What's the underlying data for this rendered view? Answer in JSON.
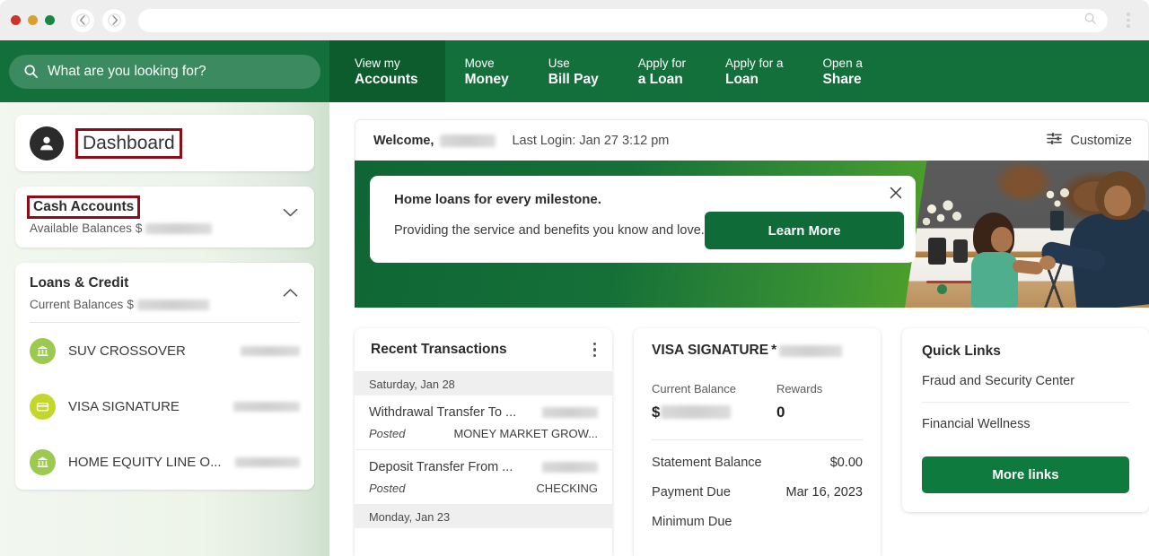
{
  "browser": {
    "back_icon": "back-arrow-icon",
    "forward_icon": "forward-arrow-icon",
    "url_value": "",
    "url_search_icon": "search-icon",
    "menu_icon": "kebab-menu-icon"
  },
  "search": {
    "placeholder": "What are you looking for?",
    "icon": "search-icon"
  },
  "nav": {
    "tabs": [
      {
        "line1": "View my",
        "line2": "Accounts",
        "active": true
      },
      {
        "line1": "Move",
        "line2": "Money",
        "active": false
      },
      {
        "line1": "Use",
        "line2": "Bill Pay",
        "active": false
      },
      {
        "line1": "Apply for",
        "line2": "a Loan",
        "active": false
      },
      {
        "line1": "Apply for a",
        "line2": "Loan",
        "active": false
      },
      {
        "line1": "Open a",
        "line2": "Share",
        "active": false
      }
    ]
  },
  "sidebar": {
    "dashboard": {
      "label": "Dashboard",
      "avatar_icon": "user-avatar-icon",
      "annotated": true
    },
    "cash_accounts": {
      "title": "Cash Accounts",
      "sub_label": "Available Balances",
      "currency": "$",
      "value_redacted": true,
      "chevron": "chevron-down-icon",
      "annotated": true
    },
    "loans_credit": {
      "title": "Loans & Credit",
      "sub_label": "Current Balances",
      "currency": "$",
      "value_redacted": true,
      "chevron": "chevron-up-icon",
      "accounts": [
        {
          "name": "SUV CROSSOVER",
          "icon": "bank-icon",
          "amount_redacted": true
        },
        {
          "name": "VISA SIGNATURE",
          "icon": "credit-card-icon",
          "amount_redacted": true
        },
        {
          "name": "HOME EQUITY LINE O...",
          "icon": "bank-icon",
          "amount_redacted": true
        }
      ]
    }
  },
  "main": {
    "welcome": {
      "greeting": "Welcome,",
      "name_redacted": true,
      "last_login": "Last Login: Jan 27 3:12 pm",
      "customize_label": "Customize",
      "customize_icon": "sliders-icon"
    },
    "banner": {
      "title": "Home loans for every milestone.",
      "subtitle": "Providing the service and benefits you know and love.",
      "cta_label": "Learn More",
      "close_icon": "close-icon",
      "photo_alt": "woman-and-child-in-home-photo"
    },
    "recent_transactions": {
      "title": "Recent Transactions",
      "menu_icon": "kebab-menu-icon",
      "groups": [
        {
          "date": "Saturday, Jan 28",
          "items": [
            {
              "description": "Withdrawal Transfer To ...",
              "amount_redacted": true,
              "status": "Posted",
              "account": "MONEY MARKET GROW..."
            },
            {
              "description": "Deposit Transfer From ...",
              "amount_redacted": true,
              "status": "Posted",
              "account": "CHECKING"
            }
          ]
        },
        {
          "date": "Monday, Jan 23",
          "items": []
        }
      ]
    },
    "visa_card": {
      "title": "VISA SIGNATURE",
      "mask_prefix": "*",
      "number_redacted": true,
      "current_balance_label": "Current Balance",
      "current_balance_currency": "$",
      "current_balance_redacted": true,
      "rewards_label": "Rewards",
      "rewards_value": "0",
      "rows": [
        {
          "label": "Statement Balance",
          "value": "$0.00"
        },
        {
          "label": "Payment Due",
          "value": "Mar 16, 2023"
        },
        {
          "label": "Minimum Due",
          "value": ""
        }
      ]
    },
    "quick_links": {
      "title": "Quick Links",
      "links": [
        "Fraud and Security Center",
        "Financial Wellness"
      ],
      "button_label": "More links"
    }
  },
  "colors": {
    "brand_green": "#13703a",
    "active_tab_green": "#0d5c2e",
    "button_green": "#0f6b37",
    "accent_lime": "#9bca4e",
    "annotation_red": "#8b0f18"
  }
}
